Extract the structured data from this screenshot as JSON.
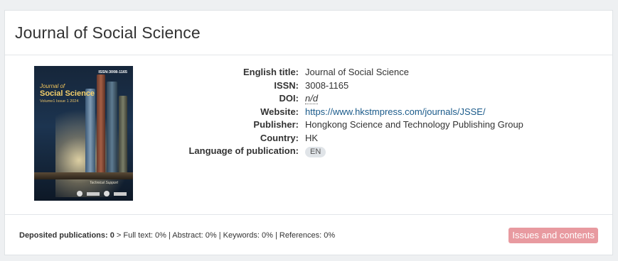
{
  "journal": {
    "title": "Journal of Social Science",
    "fields": {
      "english_title_label": "English title:",
      "english_title": "Journal of Social Science",
      "issn_label": "ISSN:",
      "issn": "3008-1165",
      "doi_label": "DOI:",
      "doi": "n/d",
      "website_label": "Website:",
      "website": "https://www.hkstmpress.com/journals/JSSE/",
      "publisher_label": "Publisher:",
      "publisher": "Hongkong Science and Technology Publishing Group",
      "country_label": "Country:",
      "country": "HK",
      "language_label": "Language of publication:",
      "language": "EN"
    },
    "cover": {
      "issn": "ISSN:3008-1165",
      "title_line1": "Journal of",
      "title_line2": "Social Science",
      "volume": "Volume1 Issue 1 2024",
      "support": "Technical Support"
    }
  },
  "footer": {
    "deposited_label": "Deposited publications: 0",
    "stats": " > Full text: 0% | Abstract: 0% | Keywords: 0% | References: 0%",
    "issues_button": "Issues and contents"
  },
  "colors": {
    "link": "#1a5a8a",
    "button_bg": "#e89aa0",
    "badge_bg": "#e0e4e8"
  }
}
